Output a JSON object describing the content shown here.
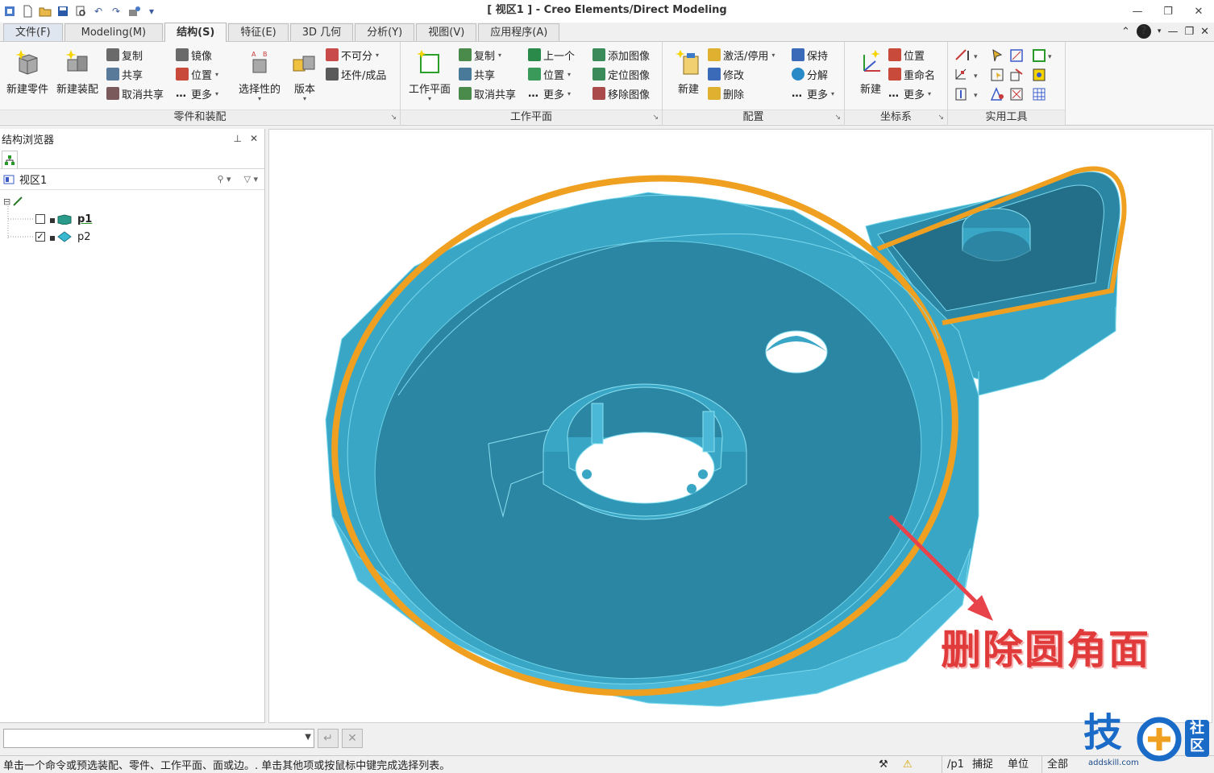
{
  "window": {
    "title": "[ 视区1 ] - Creo Elements/Direct Modeling"
  },
  "tabs": [
    {
      "label": "文件(F)"
    },
    {
      "label": "Modeling(M)"
    },
    {
      "label": "结构(S)"
    },
    {
      "label": "特征(E)"
    },
    {
      "label": "3D 几何"
    },
    {
      "label": "分析(Y)"
    },
    {
      "label": "视图(V)"
    },
    {
      "label": "应用程序(A)"
    }
  ],
  "ribbon": {
    "parts_assembly": {
      "label": "零件和装配",
      "new_part": "新建零件",
      "new_assembly": "新建装配",
      "copy": "复制",
      "share": "共享",
      "unshare": "取消共享",
      "mirror": "镜像",
      "position": "位置",
      "more": "更多",
      "selective": "选择性的",
      "version": "版本",
      "indivisible": "不可分",
      "stock_finished": "坯件/成品"
    },
    "workplane": {
      "label": "工作平面",
      "workplane": "工作平面",
      "copy": "复制",
      "share": "共享",
      "unshare": "取消共享",
      "previous": "上一个",
      "position": "位置",
      "more": "更多",
      "add_image": "添加图像",
      "locate_image": "定位图像",
      "remove_image": "移除图像"
    },
    "config": {
      "label": "配置",
      "new": "新建",
      "activate": "激活/停用",
      "modify": "修改",
      "delete": "删除",
      "keep": "保持",
      "explode": "分解",
      "more": "更多"
    },
    "coord": {
      "label": "坐标系",
      "new": "新建",
      "position": "位置",
      "rename": "重命名",
      "more": "更多"
    },
    "utility": {
      "label": "实用工具"
    }
  },
  "browser": {
    "title": "结构浏览器",
    "viewport": "视区1",
    "items": [
      {
        "name": "p1",
        "checked": false
      },
      {
        "name": "p2",
        "checked": true
      }
    ]
  },
  "canvas": {
    "annotation": "删除圆角面",
    "colors": {
      "model": "#3aa6c6",
      "model_dark": "#2b86a4",
      "highlight": "#f0a020",
      "arrow": "#e8424a"
    }
  },
  "statusbar": {
    "message": "单击一个命令或预选装配、零件、工作平面、面或边。. 单击其他项或按鼠标中键完成选择列表。",
    "path": "/p1",
    "snap": "捕捉",
    "units": "单位",
    "all": "全部"
  },
  "logo": {
    "char": "技",
    "sub": "社区",
    "url_text": "addskill.com"
  }
}
